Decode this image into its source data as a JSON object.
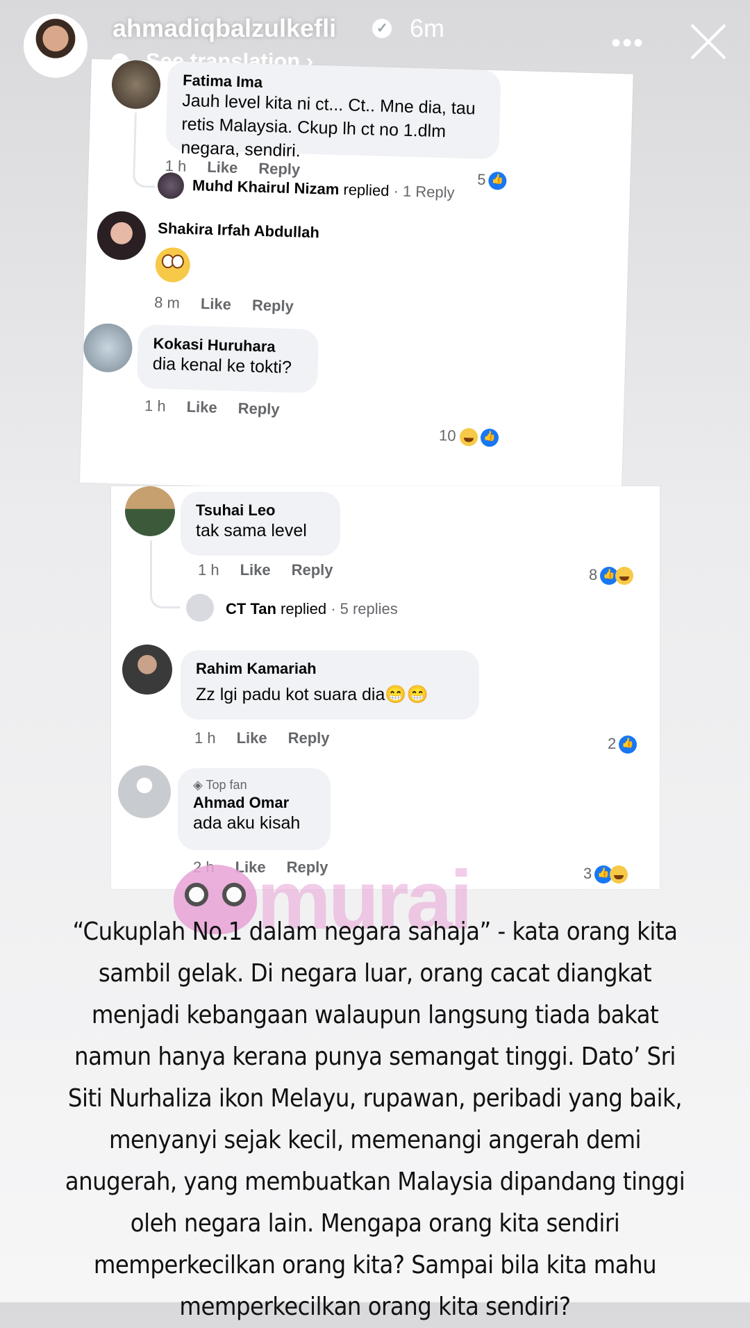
{
  "header": {
    "username": "ahmadiqbalzulkefli",
    "time": "6m",
    "see_translation": "See translation ›",
    "more": "•••"
  },
  "card1": {
    "fatima": {
      "name": "Fatima Ima",
      "text": "Jauh level kita ni ct... Ct.. Mne dia, tau retis Malaysia. Ckup lh ct no 1.dlm negara, sendiri.",
      "time": "1 h",
      "like": "Like",
      "reply": "Reply",
      "reactions": "5"
    },
    "khairul": {
      "name": "Muhd Khairul Nizam",
      "replied": " replied",
      "count": " · 1 Reply"
    },
    "shakira": {
      "name": "Shakira Irfah Abdullah",
      "time": "8 m",
      "like": "Like",
      "reply": "Reply"
    },
    "kokasi": {
      "name": "Kokasi Huruhara",
      "text": "dia kenal ke tokti?",
      "time": "1 h",
      "like": "Like",
      "reply": "Reply",
      "reactions": "10"
    }
  },
  "card2": {
    "tsuhai": {
      "name": "Tsuhai Leo",
      "text": "tak sama level",
      "time": "1 h",
      "like": "Like",
      "reply": "Reply",
      "reactions": "8"
    },
    "cttan": {
      "name": "CT Tan",
      "replied": " replied",
      "count": " · 5 replies"
    },
    "rahim": {
      "name": "Rahim Kamariah",
      "text": "Zz lgi padu kot suara dia😁😁",
      "time": "1 h",
      "like": "Like",
      "reply": "Reply",
      "reactions": "2"
    },
    "ahmad": {
      "badge": "Top fan",
      "name": "Ahmad Omar",
      "text": "ada aku kisah",
      "time": "2 h",
      "like": "Like",
      "reply": "Reply",
      "reactions": "3"
    }
  },
  "watermark": "murai",
  "caption": "“Cukuplah No.1 dalam negara sahaja” - kata orang kita sambil gelak. Di negara luar, orang cacat diangkat menjadi kebangaan walaupun langsung tiada bakat namun hanya kerana punya semangat tinggi. Dato’ Sri Siti Nurhaliza ikon Melayu, rupawan, peribadi yang baik, menyanyi sejak kecil, memenangi angerah demi anugerah, yang membuatkan Malaysia dipandang tinggi oleh negara lain. Mengapa orang kita sendiri memperkecilkan orang kita? Sampai bila kita mahu memperkecilkan orang kita sendiri?"
}
